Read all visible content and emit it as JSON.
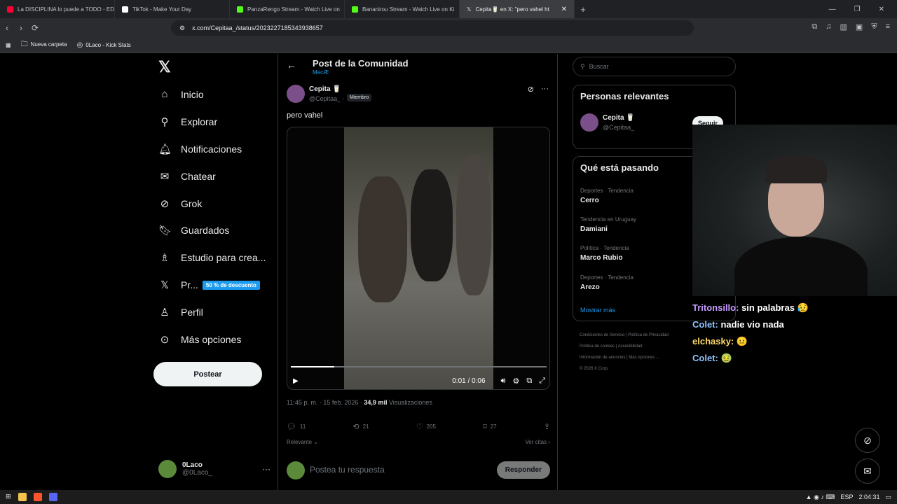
{
  "browser": {
    "tabs": [
      {
        "title": "La DISCIPLINA lo puede a TODO - ED",
        "color": "#ff0033"
      },
      {
        "title": "TikTok - Make Your Day",
        "color": "#ffffff"
      },
      {
        "title": "PanzaRengo Stream - Watch Live on",
        "color": "#53fc18"
      },
      {
        "title": "Bananirou Stream - Watch Live on Ki",
        "color": "#53fc18"
      },
      {
        "title": "Cepita🥛 en X: \"pero vahel ht",
        "color": "#ffffff"
      }
    ],
    "url": "x.com/Cepitaa_/status/2023227185343938657",
    "bookmarks": [
      "Nueva carpeta",
      "0Laco - Kick Stats"
    ]
  },
  "nav": {
    "items": [
      "Inicio",
      "Explorar",
      "Notificaciones",
      "Chatear",
      "Grok",
      "Guardados",
      "Estudio para crea...",
      "Pr...",
      "Perfil",
      "Más opciones"
    ],
    "promo": "50 % de descuento",
    "post_button": "Postear",
    "account": {
      "name": "0Laco",
      "handle": "@0Laco_"
    }
  },
  "post": {
    "header_title": "Post de la Comunidad",
    "header_sub": "MecÆ",
    "author_name": "Cepita 🥛",
    "author_handle": "@Cepitaa_ ·",
    "member_badge": "Miembro",
    "text": "pero vahel",
    "video_time": "0:01 / 0:06",
    "progress": 0.17,
    "timestamp": "11:45 p. m. · 15 feb. 2026 ·",
    "views_count": "34,9 mil",
    "views_label": "Visualizaciones",
    "replies": "11",
    "reposts": "21",
    "likes": "205",
    "bookmarks": "27",
    "sort_label": "Relevante",
    "quotes_label": "Ver citas",
    "reply_placeholder": "Postea tu respuesta",
    "reply_button": "Responder"
  },
  "sidebar": {
    "search_placeholder": "Buscar",
    "people_title": "Personas relevantes",
    "person_name": "Cepita 🥛",
    "person_handle": "@Cepitaa_",
    "follow_label": "Seguir",
    "trends_title": "Qué está pasando",
    "trends": [
      {
        "category": "Deportes · Tendencia",
        "topic": "Cerro"
      },
      {
        "category": "Tendencia en Uruguay",
        "topic": "Damiani"
      },
      {
        "category": "Política · Tendencia",
        "topic": "Marco Rubio"
      },
      {
        "category": "Deportes · Tendencia",
        "topic": "Arezo"
      }
    ],
    "show_more": "Mostrar más",
    "footer": [
      "Condiciones de Servicio",
      "Política de Privacidad",
      "Política de cookies",
      "Accesibilidad",
      "Información de anuncios",
      "Más opciones ...",
      "© 2026 X Corp."
    ]
  },
  "chat": [
    {
      "user": "Tritonsillo:",
      "msg": "sin palabras 😥"
    },
    {
      "user": "Colet:",
      "msg": "nadie vio nada"
    },
    {
      "user": "elchasky:",
      "msg": "😐"
    },
    {
      "user": "Colet:",
      "msg": "🤢"
    }
  ],
  "taskbar": {
    "lang": "ESP",
    "time": "2:04:31"
  }
}
